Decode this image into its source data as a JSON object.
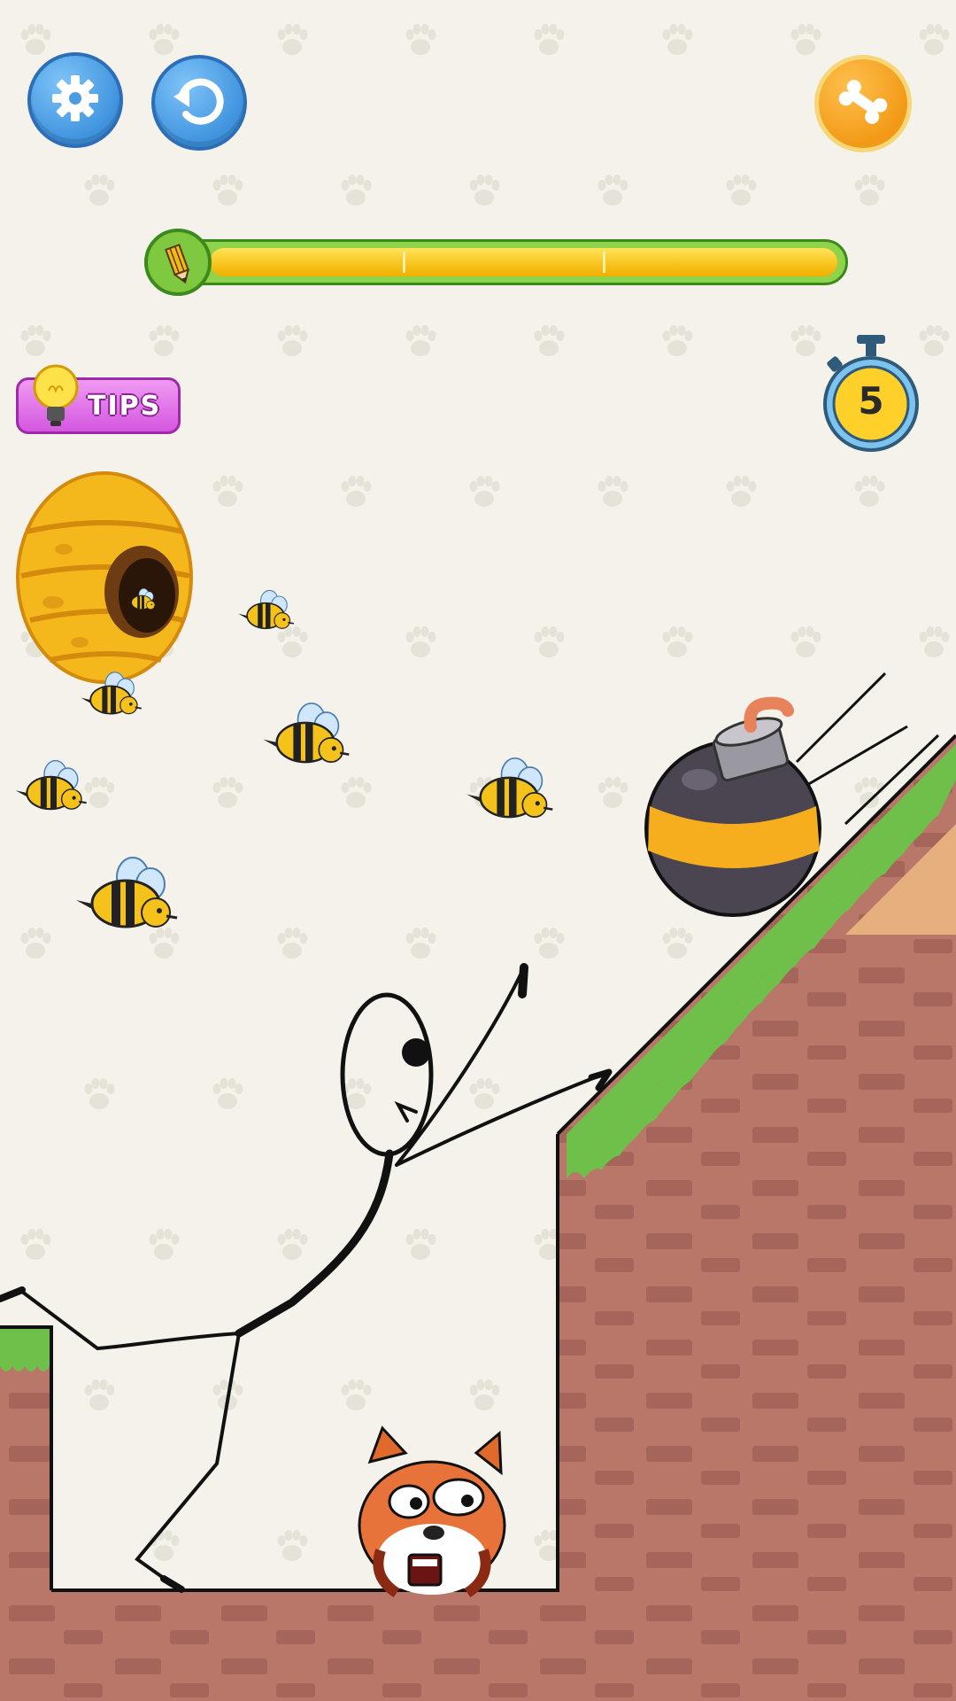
{
  "toolbar": {
    "settings_icon": "gear-icon",
    "restart_icon": "restart-icon",
    "bone_icon": "bone-icon"
  },
  "ink_meter": {
    "icon": "pencil-icon",
    "level": 1.0
  },
  "tips": {
    "label": "TIPS",
    "icon": "lightbulb-icon"
  },
  "timer": {
    "icon": "stopwatch-icon",
    "value": "5"
  },
  "colors": {
    "background": "#f4f2ea",
    "brick": "#b9776a",
    "grass": "#6fc04a",
    "bomb_stripe": "#f6ae1e",
    "tips_pink": "#e070e8"
  }
}
